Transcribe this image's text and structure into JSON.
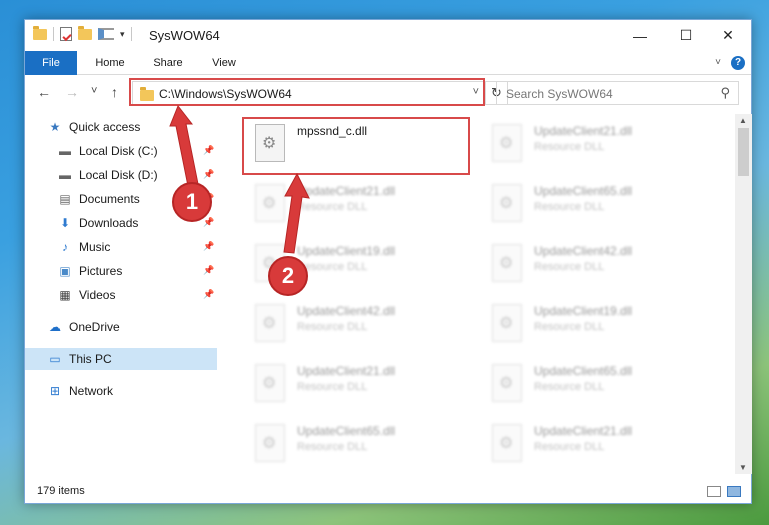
{
  "window": {
    "title": "SysWOW64",
    "controls": {
      "minimize": "—",
      "maximize": "☐",
      "close": "✕"
    }
  },
  "ribbon": {
    "tabs": [
      "File",
      "Home",
      "Share",
      "View"
    ],
    "help": "?"
  },
  "navigation": {
    "back": "←",
    "forward": "→",
    "recent": "˅",
    "up": "↑",
    "address": "C:\\Windows\\SysWOW64",
    "refresh": "↻",
    "search_placeholder": "Search SysWOW64"
  },
  "sidebar": {
    "items": [
      {
        "label": "Quick access",
        "icon": "star-icon",
        "glyph": "★",
        "pinned": false
      },
      {
        "label": "Local Disk (C:)",
        "icon": "drive-icon",
        "glyph": "▬",
        "pinned": true
      },
      {
        "label": "Local Disk (D:)",
        "icon": "drive-icon",
        "glyph": "▬",
        "pinned": true
      },
      {
        "label": "Documents",
        "icon": "documents-icon",
        "glyph": "▤",
        "pinned": true
      },
      {
        "label": "Downloads",
        "icon": "download-icon",
        "glyph": "⬇",
        "pinned": true
      },
      {
        "label": "Music",
        "icon": "music-icon",
        "glyph": "♪",
        "pinned": true
      },
      {
        "label": "Pictures",
        "icon": "pictures-icon",
        "glyph": "▣",
        "pinned": true
      },
      {
        "label": "Videos",
        "icon": "video-icon",
        "glyph": "▦",
        "pinned": true
      },
      {
        "label": "OneDrive",
        "icon": "cloud-icon",
        "glyph": "☁",
        "pinned": false
      },
      {
        "label": "This PC",
        "icon": "computer-icon",
        "glyph": "▭",
        "pinned": false,
        "selected": true
      },
      {
        "label": "Network",
        "icon": "network-icon",
        "glyph": "⊞",
        "pinned": false
      }
    ]
  },
  "files": [
    {
      "name": "mpssnd_c.dll",
      "type": ""
    },
    {
      "name": "UpdateClient21.dll",
      "type": "Resource DLL"
    },
    {
      "name": "UpdateClient21.dll",
      "type": "Resource DLL"
    },
    {
      "name": "UpdateClient65.dll",
      "type": "Resource DLL"
    },
    {
      "name": "UpdateClient19.dll",
      "type": "Resource DLL"
    },
    {
      "name": "UpdateClient42.dll",
      "type": "Resource DLL"
    },
    {
      "name": "UpdateClient42.dll",
      "type": "Resource DLL"
    },
    {
      "name": "UpdateClient19.dll",
      "type": "Resource DLL"
    },
    {
      "name": "UpdateClient21.dll",
      "type": "Resource DLL"
    },
    {
      "name": "UpdateClient65.dll",
      "type": "Resource DLL"
    },
    {
      "name": "UpdateClient65.dll",
      "type": "Resource DLL"
    },
    {
      "name": "UpdateClient21.dll",
      "type": "Resource DLL"
    }
  ],
  "status": {
    "item_count": "179 items"
  },
  "callouts": [
    "1",
    "2"
  ],
  "colors": {
    "accent": "#1a6fc4",
    "highlight": "#d84a4a",
    "selected": "#cce4f7"
  }
}
